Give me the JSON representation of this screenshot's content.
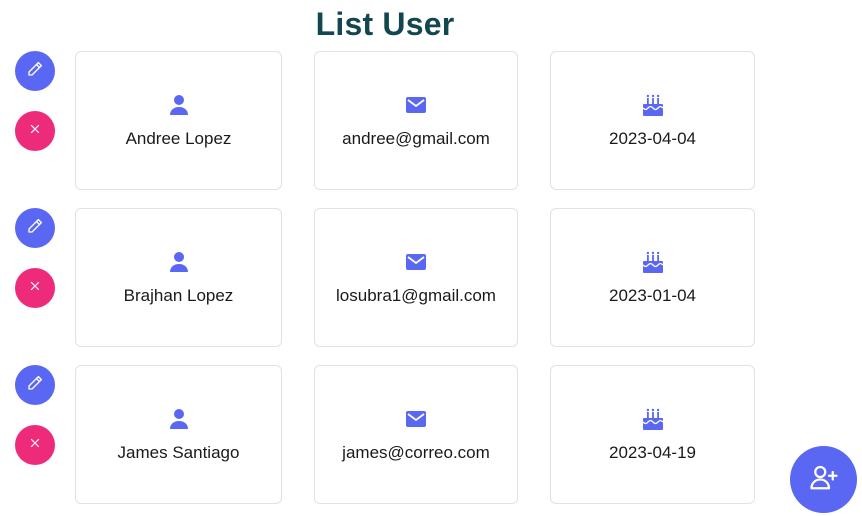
{
  "page": {
    "title": "List User"
  },
  "users": [
    {
      "name": "Andree Lopez",
      "email": "andree@gmail.com",
      "birthdate": "2023-04-04"
    },
    {
      "name": "Brajhan Lopez",
      "email": "losubra1@gmail.com",
      "birthdate": "2023-01-04"
    },
    {
      "name": "James Santiago",
      "email": "james@correo.com",
      "birthdate": "2023-04-19"
    }
  ],
  "icons": {
    "edit": "pencil-icon",
    "delete": "close-icon",
    "name": "user-icon",
    "email": "mail-icon",
    "birthdate": "cake-icon",
    "add_user": "add-user-icon"
  },
  "colors": {
    "title": "#12474f",
    "accent": "#5a67f2",
    "danger": "#ee2b7b",
    "card_border": "#e2e2e2"
  }
}
